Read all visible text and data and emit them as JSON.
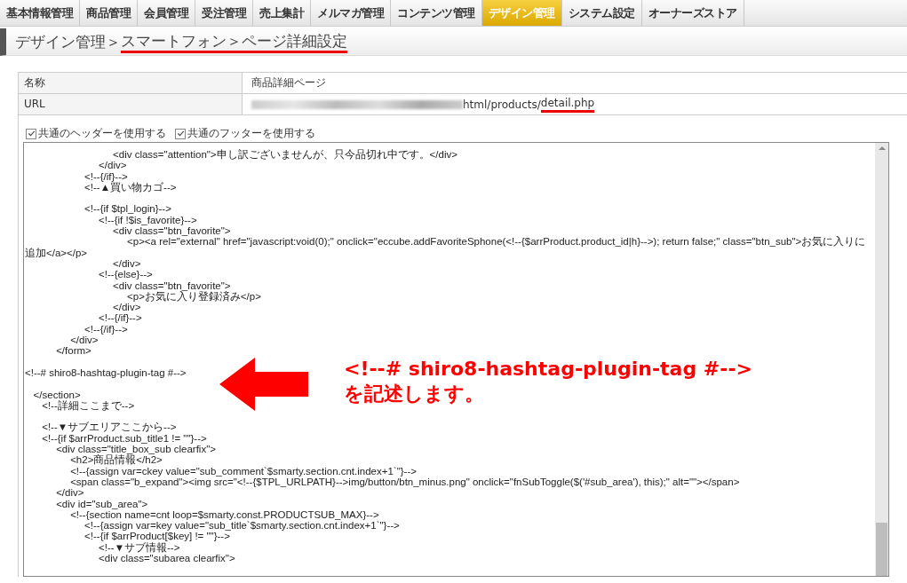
{
  "tabs": [
    {
      "label": "基本情報管理",
      "selected": false
    },
    {
      "label": "商品管理",
      "selected": false
    },
    {
      "label": "会員管理",
      "selected": false
    },
    {
      "label": "受注管理",
      "selected": false
    },
    {
      "label": "売上集計",
      "selected": false
    },
    {
      "label": "メルマガ管理",
      "selected": false
    },
    {
      "label": "コンテンツ管理",
      "selected": false
    },
    {
      "label": "デザイン管理",
      "selected": true
    },
    {
      "label": "システム設定",
      "selected": false
    },
    {
      "label": "オーナーズストア",
      "selected": false
    }
  ],
  "breadcrumb": {
    "root": "デザイン管理＞",
    "highlighted": "スマートフォン＞ページ詳細設定"
  },
  "details": [
    {
      "label": "名称",
      "value": "商品詳細ページ"
    },
    {
      "label": "URL",
      "value": "html/products/",
      "highlighted": "detail.php",
      "redacted": true
    }
  ],
  "options": [
    {
      "label": "共通のヘッダーを使用する",
      "checked": true
    },
    {
      "label": "共通のフッターを使用する",
      "checked": true
    }
  ],
  "code_lines": [
    "                               <div class=\"attention\">申し訳ございませんが、只今品切れ中です。</div>",
    "                          </div>",
    "                     <!--{/if}-->",
    "                     <!--▲買い物カゴ-->",
    {
      "blank_before": true,
      "text": "                     <!--{if $tpl_login}-->"
    },
    "                          <!--{if !$is_favorite}-->",
    "                               <div class=\"btn_favorite\">",
    "                                    <p><a rel=\"external\" href=\"javascript:void(0);\" onclick=\"eccube.addFavoriteSphone(<!--{$arrProduct.product_id|h}-->); return false;\" class=\"btn_sub\">お気に入りに追加</a></p>",
    "                               </div>",
    "                          <!--{else}-->",
    "                               <div class=\"btn_favorite\">",
    "                                    <p>お気に入り登録済み</p>",
    "                               </div>",
    "                          <!--{/if}-->",
    "                     <!--{/if}-->",
    "                </div>",
    "           </form>",
    {
      "blank_before": true,
      "text": "<!--# shiro8-hashtag-plugin-tag #-->"
    },
    {
      "blank_before": true,
      "text": "   </section>"
    },
    "      <!--詳細ここまで-->",
    {
      "blank_before": true,
      "text": "      <!--▼サブエリアここから-->"
    },
    "      <!--{if $arrProduct.sub_title1 != \"\"}-->",
    "           <div class=\"title_box_sub clearfix\">",
    "                <h2>商品情報</h2>",
    "                <!--{assign var=ckey value=\"sub_comment`$smarty.section.cnt.index+1`\"}-->",
    "                <span class=\"b_expand\"><img src=\"<!--{$TPL_URLPATH}-->img/button/btn_minus.png\" onclick=\"fnSubToggle($('#sub_area'), this);\" alt=\"\"></span>",
    "           </div>",
    "           <div id=\"sub_area\">",
    "                <!--{section name=cnt loop=$smarty.const.PRODUCTSUB_MAX}-->",
    "                     <!--{assign var=key value=\"sub_title`$smarty.section.cnt.index+1`\"}-->",
    "                     <!--{if $arrProduct[$key] != \"\"}-->",
    "                          <!--▼サブ情報-->",
    "                          <div class=\"subarea clearfix\">"
  ],
  "annotation": {
    "lines": [
      "<!--# shiro8-hashtag-plugin-tag #-->",
      "を記述します。"
    ]
  }
}
